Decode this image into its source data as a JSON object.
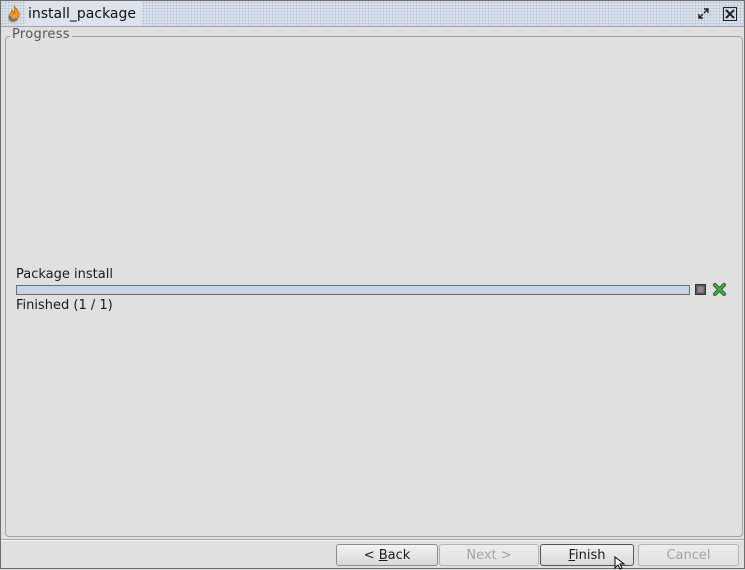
{
  "window": {
    "title": "install_package",
    "icons": {
      "app": "app-flame-icon",
      "restore": "restore-window-icon",
      "close": "close-icon"
    }
  },
  "progress_group": {
    "title": "Progress",
    "task": {
      "label": "Package install",
      "progress_fraction": 1.0,
      "status": "Finished (1 / 1)",
      "icons": {
        "stop": "stop-icon",
        "cancel": "cancel-x-icon"
      }
    }
  },
  "buttons": {
    "back": {
      "prefix": "< ",
      "mnemonic": "B",
      "rest": "ack",
      "enabled": true
    },
    "next": {
      "label": "Next >",
      "enabled": false
    },
    "finish": {
      "mnemonic": "F",
      "rest": "inish",
      "enabled": true
    },
    "cancel": {
      "label": "Cancel",
      "enabled": false
    }
  },
  "colors": {
    "progress_fill": "#c5d4e6",
    "cancel_icon": "#2e8b2e",
    "background": "#e0e0e0"
  }
}
